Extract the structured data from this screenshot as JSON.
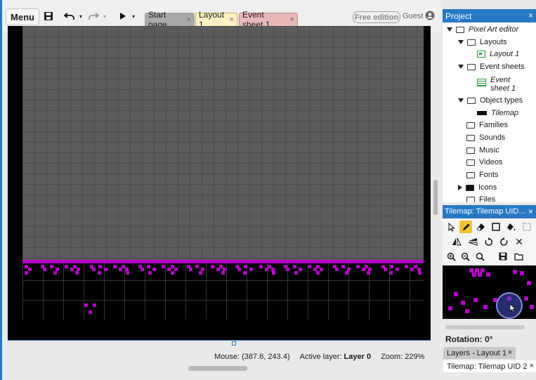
{
  "toolbar": {
    "menu_label": "Menu",
    "tabs": [
      {
        "label": "Start page",
        "close": "×"
      },
      {
        "label": "Layout 1",
        "close": "×"
      },
      {
        "label": "Event sheet 1",
        "close": "×"
      }
    ],
    "edition_badge": "Free edition",
    "user_label": "Guest"
  },
  "status": {
    "mouse": "Mouse: (387.6, 243.4)",
    "active_layer_label": "Active layer:",
    "active_layer_value": "Layer 0",
    "zoom": "Zoom: 229%"
  },
  "project_panel": {
    "title": "Project",
    "close": "×",
    "items": [
      {
        "label": "Pixel Art editor"
      },
      {
        "label": "Layouts"
      },
      {
        "label": "Layout 1"
      },
      {
        "label": "Event sheets"
      },
      {
        "label": "Event sheet 1"
      },
      {
        "label": "Object types"
      },
      {
        "label": "Tilemap"
      },
      {
        "label": "Families"
      },
      {
        "label": "Sounds"
      },
      {
        "label": "Music"
      },
      {
        "label": "Videos"
      },
      {
        "label": "Fonts"
      },
      {
        "label": "Icons"
      },
      {
        "label": "Files"
      }
    ]
  },
  "tilemap_panel": {
    "title": "Tilemap: Tilemap UID...",
    "close": "×",
    "tools": [
      "select-tool",
      "pencil-tool",
      "eraser-tool",
      "rectangle-tool",
      "fill-tool",
      "selection-tool",
      "flip-horizontal-tool",
      "flip-vertical-tool",
      "rotate-ccw-tool",
      "rotate-cw-tool",
      "reset-tool",
      "zoom-in-tool",
      "zoom-out-tool",
      "zoom-reset-tool",
      "save-tool",
      "open-tool"
    ],
    "rotation_label": "Rotation: 0°"
  },
  "bottom_tabs": {
    "layers": "Layers - Layout 1",
    "layers_close": "×",
    "tilemap": "Tilemap: Tilemap UID 2",
    "tilemap_close": "×"
  },
  "colors": {
    "accent_blue": "#2779c4",
    "tile_magenta": "#b400c8",
    "layout_tab": "#fdf1c4",
    "eventsheet_tab": "#e8b8b8",
    "startpage_tab": "#a8a8a8"
  }
}
